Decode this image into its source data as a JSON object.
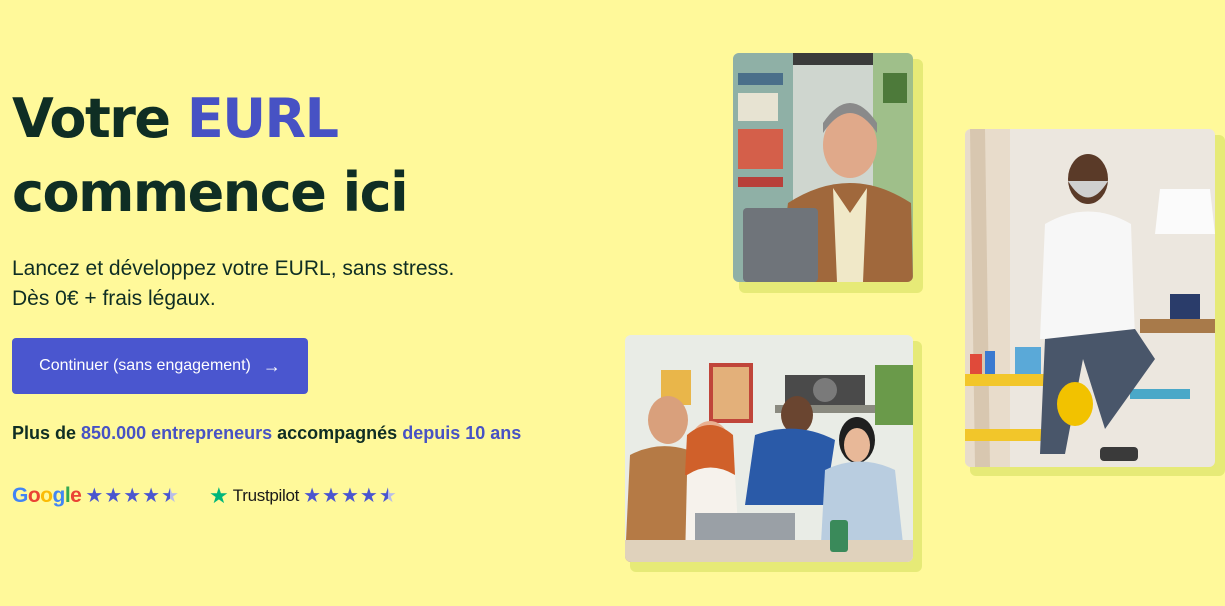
{
  "hero": {
    "title_part1": "Votre ",
    "title_accent": "EURL",
    "title_part2": "commence ici",
    "subtitle_line1": "Lancez et développez votre EURL, sans stress.",
    "subtitle_line2": "Dès 0€ + frais légaux.",
    "cta_label": "Continuer (sans engagement)",
    "cta_arrow": "→"
  },
  "social_proof": {
    "prefix": "Plus de ",
    "count": "850.000 entrepreneurs",
    "middle": " accompagnés ",
    "since": "depuis 10 ans"
  },
  "ratings": [
    {
      "source": "Google",
      "stars": 4.5
    },
    {
      "source": "Trustpilot",
      "stars": 4.5
    }
  ],
  "photos": [
    {
      "subject": "smiling man at laptop in bookshop"
    },
    {
      "subject": "man standing with helmet in workshop"
    },
    {
      "subject": "team of four around laptop"
    }
  ],
  "colors": {
    "background": "#fff99a",
    "accent": "#4752c4",
    "dark": "#0f2e24",
    "button": "#4a56cf"
  }
}
